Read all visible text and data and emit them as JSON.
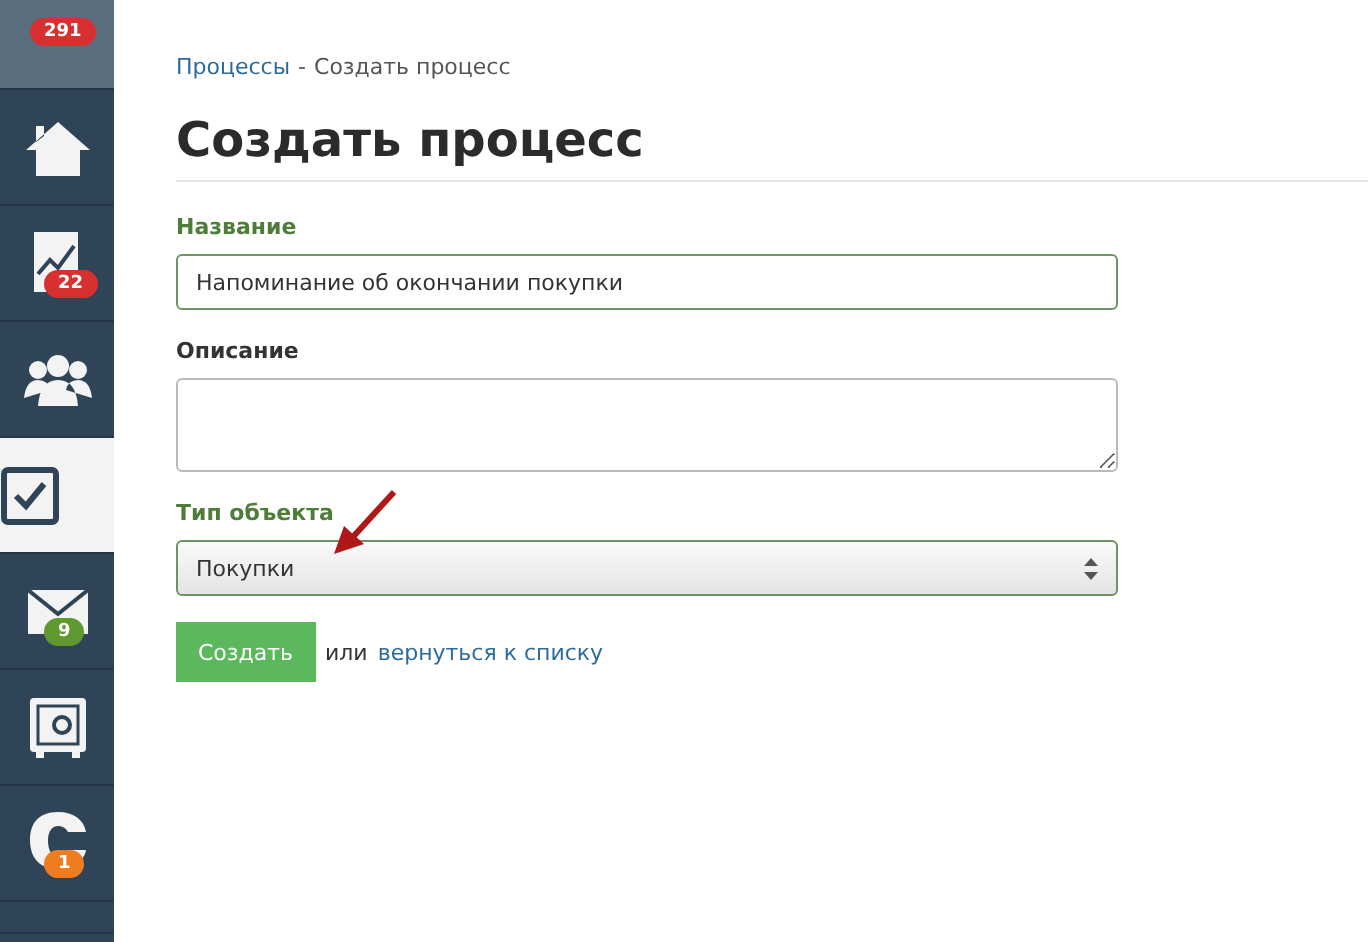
{
  "sidebar": {
    "items": [
      {
        "kind": "top",
        "selected": false,
        "badge": "291",
        "color": "#d63031"
      },
      {
        "kind": "home",
        "selected": false
      },
      {
        "kind": "chart",
        "selected": false,
        "badge": "22",
        "color": "#d63031"
      },
      {
        "kind": "people",
        "selected": false
      },
      {
        "kind": "tasks",
        "selected": true
      },
      {
        "kind": "mail",
        "selected": false,
        "badge": "9",
        "color": "#5e9a2f"
      },
      {
        "kind": "safe",
        "selected": false
      },
      {
        "kind": "chat",
        "selected": false,
        "badge": "1",
        "color": "#ee7d22"
      },
      {
        "kind": "bottom",
        "selected": false
      }
    ]
  },
  "breadcrumb": {
    "link": "Процессы",
    "separator": "-",
    "current": "Создать процесс"
  },
  "title": "Создать процесс",
  "form": {
    "fields": [
      {
        "kind": "input",
        "label": "Название",
        "value": "Напоминание об окончании покупки",
        "highlighted": true
      },
      {
        "kind": "textarea",
        "label": "Описание",
        "highlighted": false
      },
      {
        "kind": "select",
        "label": "Тип объекта",
        "value": "Покупки",
        "highlighted": true
      }
    ],
    "submit": "Создать",
    "or_text": "или",
    "back_link": "вернуться к списку"
  }
}
